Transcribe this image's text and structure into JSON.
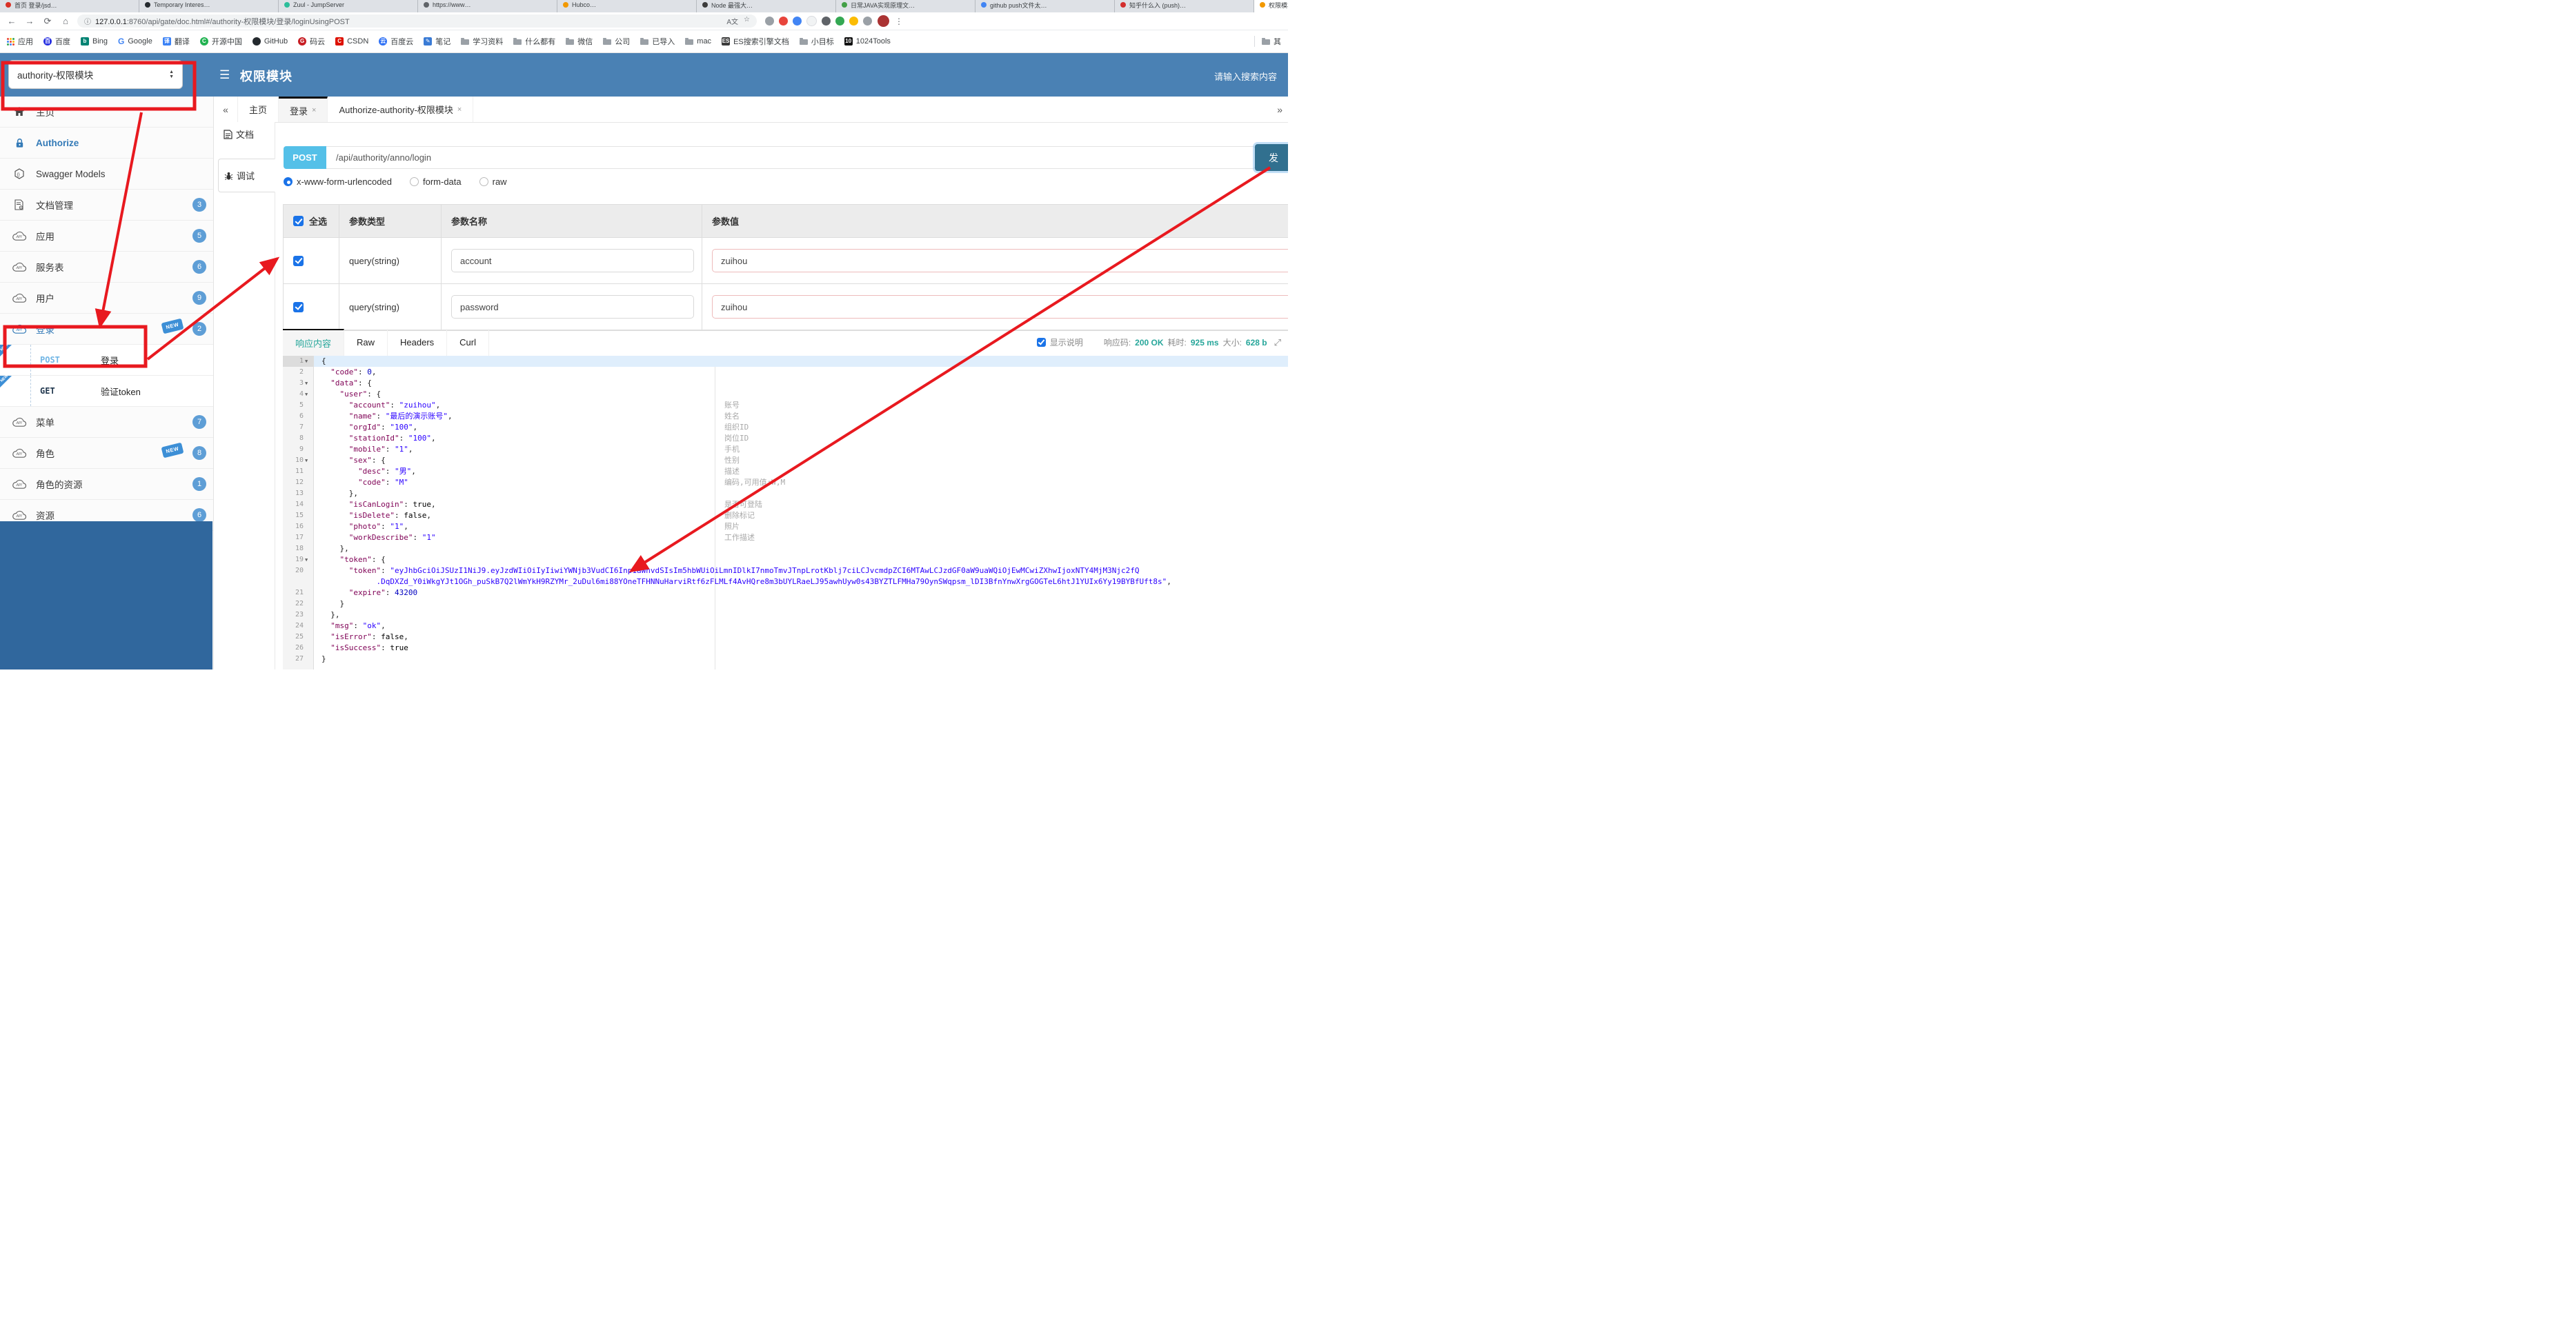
{
  "colors": {
    "header_blue": "#4a81b4",
    "accent_blue": "#337ab7",
    "badge_blue": "#5e9ed6",
    "new_tag_blue": "#3d8fd6",
    "post_badge": "#54c0e8",
    "send_button": "#31708f",
    "teal": "#26a69a",
    "annotation_red": "#e8191f",
    "json_key": "#7f0055",
    "json_string": "#2a00ff",
    "json_number": "#0000c0",
    "value_input_border": "#eebbbb"
  },
  "browser": {
    "tabs": [
      {
        "title": "首页 登录/jsd…",
        "color": "#d93025"
      },
      {
        "title": "Temporary Interes…",
        "color": "#24292e"
      },
      {
        "title": "Zuul - JumpServer",
        "color": "#2dbe9b"
      },
      {
        "title": "https://www…",
        "color": "#5f6368"
      },
      {
        "title": "Hubco…",
        "color": "#f29900"
      },
      {
        "title": "Node 最强大…",
        "color": "#3c3c3c"
      },
      {
        "title": "日常JAVA实现原理文…",
        "color": "#43a047"
      },
      {
        "title": "github push文件太…",
        "color": "#4285f4"
      },
      {
        "title": "知乎什么入 (push)…",
        "color": "#d32f2f"
      }
    ],
    "active_tab": {
      "title": "权限模块",
      "color": "#f29900"
    },
    "new_tab_button": "+",
    "nav": {
      "back": "←",
      "forward": "→",
      "reload": "⟳",
      "home": "⌂"
    },
    "url_host": "127.0.0.1",
    "url_path": ":8760/api/gate/doc.html#/authority-权限模块/登录/loginUsingPOST",
    "url_info_icon": "ⓘ",
    "url_right_icons": [
      "translate-icon",
      "bookmark-star-icon"
    ],
    "extension_icon_colors": [
      "#9aa0a6",
      "#e8453c",
      "#4285f4",
      "#f1f3f4",
      "#5f6368",
      "#34a853",
      "#fbbc04",
      "#9aa0a6"
    ],
    "bookmarks": [
      {
        "label": "应用",
        "icon": "apps"
      },
      {
        "label": "百度",
        "icon": "circle",
        "color": "#2932e1",
        "glyph": "百"
      },
      {
        "label": "Bing",
        "icon": "square",
        "color": "#008373",
        "glyph": "b"
      },
      {
        "label": "Google",
        "icon": "glyph",
        "color": "#4285f4",
        "glyph": "G"
      },
      {
        "label": "翻译",
        "icon": "square",
        "color": "#3b82f6",
        "glyph": "译"
      },
      {
        "label": "开源中国",
        "icon": "circle",
        "color": "#21b351",
        "glyph": "C"
      },
      {
        "label": "GitHub",
        "icon": "circle",
        "color": "#24292e",
        "glyph": ""
      },
      {
        "label": "码云",
        "icon": "circle",
        "color": "#c71d23",
        "glyph": "G"
      },
      {
        "label": "CSDN",
        "icon": "square",
        "color": "#dd1100",
        "glyph": "C"
      },
      {
        "label": "百度云",
        "icon": "circle",
        "color": "#3072f6",
        "glyph": "云"
      },
      {
        "label": "笔记",
        "icon": "square",
        "color": "#3a7bd5",
        "glyph": "✎"
      },
      {
        "label": "学习资料",
        "icon": "folder"
      },
      {
        "label": "什么都有",
        "icon": "folder"
      },
      {
        "label": "微信",
        "icon": "folder"
      },
      {
        "label": "公司",
        "icon": "folder"
      },
      {
        "label": "已导入",
        "icon": "folder"
      },
      {
        "label": "mac",
        "icon": "folder"
      },
      {
        "label": "ES搜索引擎文档",
        "icon": "square",
        "color": "#3b3b3b",
        "glyph": "ES"
      },
      {
        "label": "小目标",
        "icon": "folder"
      },
      {
        "label": "1024Tools",
        "icon": "square",
        "color": "#111111",
        "glyph": "10"
      }
    ],
    "bookmarks_right": {
      "label": "其",
      "icon": "folder"
    }
  },
  "header": {
    "module_select_value": "authority-权限模块",
    "hamburger": "☰",
    "title": "权限模块",
    "search_placeholder": "请输入搜索内容"
  },
  "sidebar": {
    "items": [
      {
        "label": "主页",
        "icon": "home"
      },
      {
        "label": "Authorize",
        "icon": "lock",
        "active": true
      },
      {
        "label": "Swagger Models",
        "icon": "hex"
      },
      {
        "label": "文档管理",
        "icon": "docgear",
        "badge": "3"
      },
      {
        "label": "应用",
        "icon": "cloud",
        "badge": "5"
      },
      {
        "label": "服务表",
        "icon": "cloud",
        "badge": "6"
      },
      {
        "label": "用户",
        "icon": "cloud",
        "badge": "9"
      },
      {
        "label": "登录",
        "icon": "cloud",
        "badge": "2",
        "new_tag": true,
        "blue": true
      },
      {
        "label": "登录",
        "method": "POST",
        "sub": true,
        "new_corner": true
      },
      {
        "label": "验证token",
        "method": "GET",
        "sub": true,
        "new_corner": true
      },
      {
        "label": "菜单",
        "icon": "cloud",
        "badge": "7"
      },
      {
        "label": "角色",
        "icon": "cloud",
        "badge": "8",
        "new_tag": true
      },
      {
        "label": "角色的资源",
        "icon": "cloud",
        "badge": "1"
      },
      {
        "label": "资源",
        "icon": "cloud",
        "badge": "6"
      }
    ]
  },
  "doc_tabs": {
    "back": "«",
    "forward": "»",
    "tabs": [
      {
        "label": "主页",
        "closable": false,
        "active": false
      },
      {
        "label": "登录",
        "closable": true,
        "active": true
      },
      {
        "label": "Authorize-authority-权限模块",
        "closable": true,
        "active": false
      }
    ]
  },
  "rail": {
    "doc_label": "文档",
    "debug_label": "调试"
  },
  "endpoint": {
    "method": "POST",
    "url": "/api/authority/anno/login",
    "send_label": "发"
  },
  "body_types": {
    "options": [
      "x-www-form-urlencoded",
      "form-data",
      "raw"
    ],
    "selected": "x-www-form-urlencoded"
  },
  "params_table": {
    "headers": [
      "全选",
      "参数类型",
      "参数名称",
      "参数值"
    ],
    "rows": [
      {
        "checked": true,
        "type": "query(string)",
        "name": "account",
        "value": "zuihou"
      },
      {
        "checked": true,
        "type": "query(string)",
        "name": "password",
        "value": "zuihou"
      }
    ]
  },
  "response": {
    "tabs": [
      "响应内容",
      "Raw",
      "Headers",
      "Curl"
    ],
    "active_tab": "响应内容",
    "show_desc_label": "显示说明",
    "show_desc_checked": true,
    "meta": [
      {
        "label": "响应码:",
        "value": "200 OK"
      },
      {
        "label": "耗时:",
        "value": "925 ms"
      },
      {
        "label": "大小:",
        "value": "628 b"
      }
    ]
  },
  "editor": {
    "rows": [
      {
        "n": "1",
        "fold": true,
        "hl": true,
        "seg": [
          [
            "p",
            "{"
          ]
        ]
      },
      {
        "n": "2",
        "seg": [
          [
            "w",
            "  "
          ],
          [
            "k",
            "\"code\""
          ],
          [
            "p",
            ": "
          ],
          [
            "n",
            "0"
          ],
          [
            "p",
            ","
          ]
        ]
      },
      {
        "n": "3",
        "fold": true,
        "seg": [
          [
            "w",
            "  "
          ],
          [
            "k",
            "\"data\""
          ],
          [
            "p",
            ": {"
          ]
        ]
      },
      {
        "n": "4",
        "fold": true,
        "seg": [
          [
            "w",
            "    "
          ],
          [
            "k",
            "\"user\""
          ],
          [
            "p",
            ": {"
          ]
        ]
      },
      {
        "n": "5",
        "ann": "账号",
        "seg": [
          [
            "w",
            "      "
          ],
          [
            "k",
            "\"account\""
          ],
          [
            "p",
            ": "
          ],
          [
            "s",
            "\"zuihou\""
          ],
          [
            "p",
            ","
          ]
        ]
      },
      {
        "n": "6",
        "ann": "姓名",
        "seg": [
          [
            "w",
            "      "
          ],
          [
            "k",
            "\"name\""
          ],
          [
            "p",
            ": "
          ],
          [
            "s",
            "\"最后的演示账号\""
          ],
          [
            "p",
            ","
          ]
        ]
      },
      {
        "n": "7",
        "ann": "组织ID",
        "seg": [
          [
            "w",
            "      "
          ],
          [
            "k",
            "\"orgId\""
          ],
          [
            "p",
            ": "
          ],
          [
            "s",
            "\"100\""
          ],
          [
            "p",
            ","
          ]
        ]
      },
      {
        "n": "8",
        "ann": "岗位ID",
        "seg": [
          [
            "w",
            "      "
          ],
          [
            "k",
            "\"stationId\""
          ],
          [
            "p",
            ": "
          ],
          [
            "s",
            "\"100\""
          ],
          [
            "p",
            ","
          ]
        ]
      },
      {
        "n": "9",
        "ann": "手机",
        "seg": [
          [
            "w",
            "      "
          ],
          [
            "k",
            "\"mobile\""
          ],
          [
            "p",
            ": "
          ],
          [
            "s",
            "\"1\""
          ],
          [
            "p",
            ","
          ]
        ]
      },
      {
        "n": "10",
        "fold": true,
        "ann": "性别",
        "seg": [
          [
            "w",
            "      "
          ],
          [
            "k",
            "\"sex\""
          ],
          [
            "p",
            ": {"
          ]
        ]
      },
      {
        "n": "11",
        "ann": "描述",
        "seg": [
          [
            "w",
            "        "
          ],
          [
            "k",
            "\"desc\""
          ],
          [
            "p",
            ": "
          ],
          [
            "s",
            "\"男\""
          ],
          [
            "p",
            ","
          ]
        ]
      },
      {
        "n": "12",
        "ann": "编码,可用值:W,M",
        "seg": [
          [
            "w",
            "        "
          ],
          [
            "k",
            "\"code\""
          ],
          [
            "p",
            ": "
          ],
          [
            "s",
            "\"M\""
          ]
        ]
      },
      {
        "n": "13",
        "seg": [
          [
            "w",
            "      "
          ],
          [
            "p",
            "},"
          ]
        ]
      },
      {
        "n": "14",
        "ann": "是否可登陆",
        "seg": [
          [
            "w",
            "      "
          ],
          [
            "k",
            "\"isCanLogin\""
          ],
          [
            "p",
            ": "
          ],
          [
            "b",
            "true"
          ],
          [
            "p",
            ","
          ]
        ]
      },
      {
        "n": "15",
        "ann": "删除标记",
        "seg": [
          [
            "w",
            "      "
          ],
          [
            "k",
            "\"isDelete\""
          ],
          [
            "p",
            ": "
          ],
          [
            "b",
            "false"
          ],
          [
            "p",
            ","
          ]
        ]
      },
      {
        "n": "16",
        "ann": "照片",
        "seg": [
          [
            "w",
            "      "
          ],
          [
            "k",
            "\"photo\""
          ],
          [
            "p",
            ": "
          ],
          [
            "s",
            "\"1\""
          ],
          [
            "p",
            ","
          ]
        ]
      },
      {
        "n": "17",
        "ann": "工作描述",
        "seg": [
          [
            "w",
            "      "
          ],
          [
            "k",
            "\"workDescribe\""
          ],
          [
            "p",
            ": "
          ],
          [
            "s",
            "\"1\""
          ]
        ]
      },
      {
        "n": "18",
        "seg": [
          [
            "w",
            "    "
          ],
          [
            "p",
            "},"
          ]
        ]
      },
      {
        "n": "19",
        "fold": true,
        "seg": [
          [
            "w",
            "    "
          ],
          [
            "k",
            "\"token\""
          ],
          [
            "p",
            ": {"
          ]
        ]
      },
      {
        "n": "20",
        "seg": [
          [
            "w",
            "      "
          ],
          [
            "k",
            "\"token\""
          ],
          [
            "p",
            ": "
          ],
          [
            "s",
            "\"eyJhbGciOiJSUzI1NiJ9.eyJzdWIiOiIyIiwiYWNjb3VudCI6Inp1aWhvdSIsIm5hbWUiOiLmnIDlkI7nmoTmvJTnpLrotKblj7ciLCJvcmdpZCI6MTAwLCJzdGF0aW9uaWQiOjEwMCwiZXhwIjoxNTY4MjM3Njc2fQ"
          ]
        ]
      },
      {
        "n": "",
        "seg": [
          [
            "w",
            "            "
          ],
          [
            "s",
            ".DqDXZd_Y0iWkgYJt1OGh_puSkB7Q2lWmYkH9RZYMr_2uDul6mi88YOneTFHNNuHarviRtf6zFLMLf4AvHQre8m3bUYLRaeLJ95awhUyw0s43BYZTLFMHa79OynSWqpsm_lDI3BfnYnwXrgGOGTeL6htJ1YUIx6Yy19BYBfUft8s\""
          ],
          [
            "p",
            ","
          ]
        ]
      },
      {
        "n": "21",
        "seg": [
          [
            "w",
            "      "
          ],
          [
            "k",
            "\"expire\""
          ],
          [
            "p",
            ": "
          ],
          [
            "n",
            "43200"
          ]
        ]
      },
      {
        "n": "22",
        "seg": [
          [
            "w",
            "    "
          ],
          [
            "p",
            "}"
          ]
        ]
      },
      {
        "n": "23",
        "seg": [
          [
            "w",
            "  "
          ],
          [
            "p",
            "},"
          ]
        ]
      },
      {
        "n": "24",
        "seg": [
          [
            "w",
            "  "
          ],
          [
            "k",
            "\"msg\""
          ],
          [
            "p",
            ": "
          ],
          [
            "s",
            "\"ok\""
          ],
          [
            "p",
            ","
          ]
        ]
      },
      {
        "n": "25",
        "seg": [
          [
            "w",
            "  "
          ],
          [
            "k",
            "\"isError\""
          ],
          [
            "p",
            ": "
          ],
          [
            "b",
            "false"
          ],
          [
            "p",
            ","
          ]
        ]
      },
      {
        "n": "26",
        "seg": [
          [
            "w",
            "  "
          ],
          [
            "k",
            "\"isSuccess\""
          ],
          [
            "p",
            ": "
          ],
          [
            "b",
            "true"
          ]
        ]
      },
      {
        "n": "27",
        "seg": [
          [
            "p",
            "}"
          ]
        ]
      }
    ]
  }
}
